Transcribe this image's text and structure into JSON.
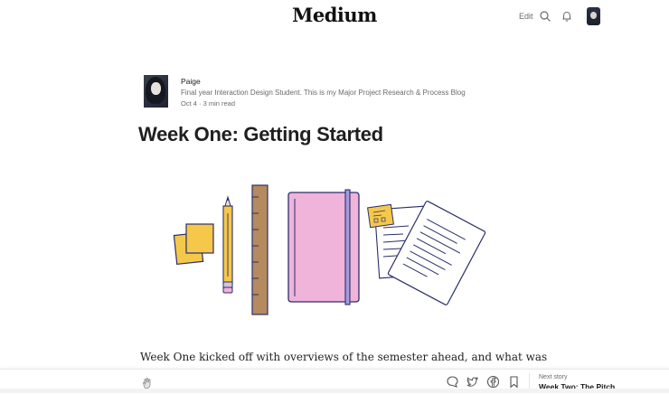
{
  "app": {
    "logo": "Medium"
  },
  "header": {
    "edit_label": "Edit"
  },
  "author": {
    "name": "Paige",
    "bio": "Final year Interaction Design Student. This is my Major Project Research & Process Blog",
    "meta": "Oct 4 · 3 min read"
  },
  "article": {
    "title": "Week One: Getting Started",
    "first_line": "Week One kicked off with overviews of the semester ahead, and what was"
  },
  "bottom_bar": {
    "next_label": "Next story",
    "next_title": "Week Two: The Pitch"
  },
  "colors": {
    "pink": "#f0b3d9",
    "yellow": "#f5c84a",
    "wood": "#b48a5e",
    "ink": "#2a2f6b",
    "paper": "#ffffff"
  },
  "icons": [
    "search-icon",
    "bell-icon",
    "clap-icon",
    "comment-icon",
    "twitter-icon",
    "facebook-icon",
    "bookmark-icon"
  ]
}
